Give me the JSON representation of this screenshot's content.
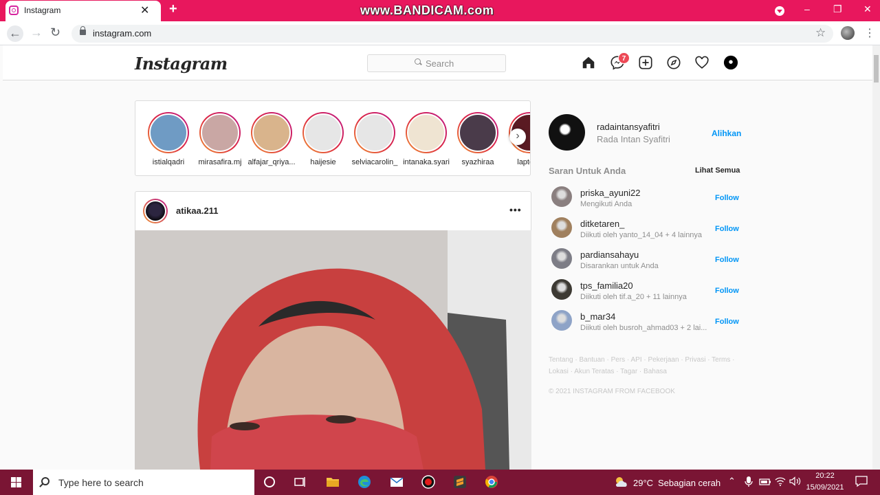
{
  "browser": {
    "tab_title": "Instagram",
    "tab_close": "✕",
    "new_tab": "+",
    "watermark": "www.BANDICAM.com",
    "url": "instagram.com",
    "window_controls": [
      "–",
      "❐",
      "✕"
    ]
  },
  "instagram": {
    "logo": "Instagram",
    "search_placeholder": "Search",
    "notification_badge": "7",
    "stories": [
      {
        "name": "istialqadri",
        "color": "#6f9bc4"
      },
      {
        "name": "mirasafira.mj",
        "color": "#c9a7a4"
      },
      {
        "name": "alfajar_qriya...",
        "color": "#d9b48c"
      },
      {
        "name": "haijesie",
        "color": "#e6e6e6"
      },
      {
        "name": "selviacarolin_",
        "color": "#e6e6e6"
      },
      {
        "name": "intanaka.syari",
        "color": "#efe4d2"
      },
      {
        "name": "syazhiraa",
        "color": "#4a3b4a"
      },
      {
        "name": "laptops",
        "color": "#5a1a22"
      }
    ],
    "post": {
      "username": "atikaa.211",
      "more": "•••"
    },
    "me": {
      "username": "radaintansyafitri",
      "name": "Rada Intan Syafitri",
      "switch": "Alihkan"
    },
    "suggestions": {
      "title": "Saran Untuk Anda",
      "see_all": "Lihat Semua",
      "items": [
        {
          "username": "priska_ayuni22",
          "sub": "Mengikuti Anda",
          "follow": "Follow",
          "color": "#8a7f7f"
        },
        {
          "username": "ditketaren_",
          "sub": "Diikuti oleh yanto_14_04 + 4 lainnya",
          "follow": "Follow",
          "color": "#a0805e"
        },
        {
          "username": "pardiansahayu",
          "sub": "Disarankan untuk Anda",
          "follow": "Follow",
          "color": "#7d7d86"
        },
        {
          "username": "tps_familia20",
          "sub": "Diikuti oleh tif.a_20 + 11 lainnya",
          "follow": "Follow",
          "color": "#3d3a33"
        },
        {
          "username": "b_mar34",
          "sub": "Diikuti oleh busroh_ahmad03 + 2 lai...",
          "follow": "Follow",
          "color": "#8ea3c7"
        }
      ]
    },
    "footer_links": "Tentang · Bantuan · Pers · API · Pekerjaan · Privasi · Terms · Lokasi · Akun Teratas · Tagar · Bahasa",
    "copyright": "© 2021 INSTAGRAM FROM FACEBOOK"
  },
  "taskbar": {
    "search_placeholder": "Type here to search",
    "temp": "29°C",
    "weather": "Sebagian cerah",
    "time": "20:22",
    "date": "15/09/2021"
  },
  "colors": {
    "titlebar": "#e8175d",
    "taskbar": "#7a1534",
    "ig_blue": "#0095f6"
  }
}
